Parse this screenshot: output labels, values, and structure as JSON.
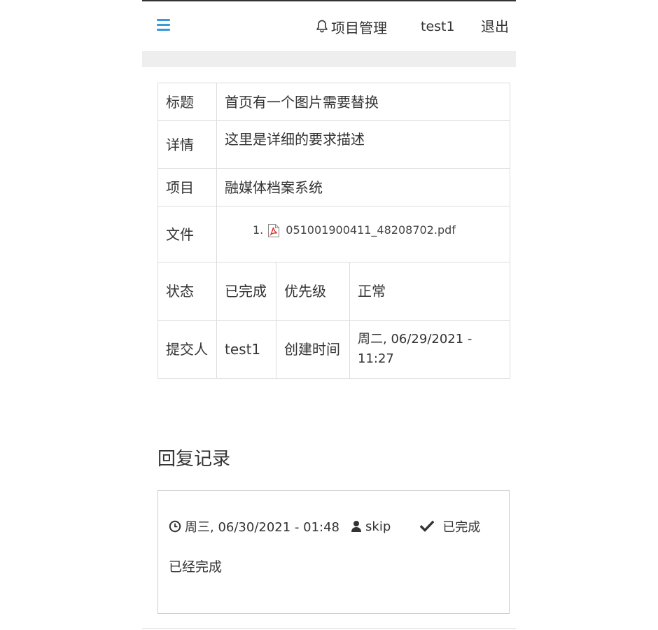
{
  "navbar": {
    "project_label": "项目管理",
    "user": "test1",
    "logout": "退出"
  },
  "detail": {
    "title_label": "标题",
    "title_value": "首页有一个图片需要替换",
    "detail_label": "详情",
    "detail_value": "这里是详细的要求描述",
    "project_label": "项目",
    "project_value": "融媒体档案系统",
    "files_label": "文件",
    "files": [
      {
        "index": "1.",
        "name": "051001900411_48208702.pdf"
      }
    ],
    "status_label": "状态",
    "status_value": "已完成",
    "priority_label": "优先级",
    "priority_value": "正常",
    "submitter_label": "提交人",
    "submitter_value": "test1",
    "created_label": "创建时间",
    "created_value": "周二, 06/29/2021 - 11:27"
  },
  "replies": {
    "heading": "回复记录",
    "items": [
      {
        "time": "周三, 06/30/2021 - 01:48",
        "user": "skip",
        "status": "已完成",
        "body": "已经完成"
      }
    ]
  },
  "colors": {
    "accent": "#3a9ad9",
    "border": "#dddddd",
    "band": "#eeeeee",
    "pdf_red": "#d9302c"
  },
  "icons": {
    "menu": "hamburger-icon",
    "project": "bell-icon",
    "file": "pdf-file-icon",
    "time": "clock-icon",
    "user": "user-icon",
    "status": "check-icon"
  }
}
